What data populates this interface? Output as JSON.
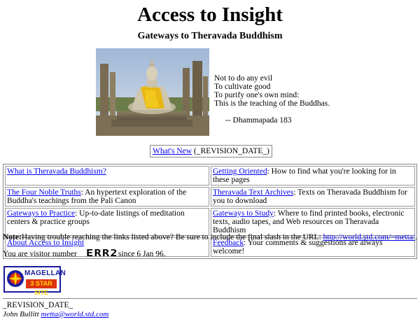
{
  "header": {
    "title": "Access to Insight",
    "subtitle": "Gateways to Theravada Buddhism"
  },
  "hero": {
    "image": "buddha-statue-photo"
  },
  "quote": {
    "lines": [
      "Not to do any evil",
      "To cultivate good",
      "To purify one's own mind:",
      "This is the teaching of the Buddhas."
    ],
    "attribution": "-- Dhammapada 183"
  },
  "whats_new": {
    "link": "What's New",
    "date": "(_REVISION_DATE_)"
  },
  "nav": [
    [
      {
        "link": "What is Theravada Buddhism?",
        "desc": ""
      },
      {
        "link": "Getting Oriented",
        "desc": ": How to find what you're looking for in these pages"
      }
    ],
    [
      {
        "link": "The Four Noble Truths",
        "desc": ": An hypertext exploration of the Buddha's teachings from the Pali Canon"
      },
      {
        "link": "Theravada Text Archives",
        "desc": ": Texts on Theravada Buddhism for you to download"
      }
    ],
    [
      {
        "link": "Gateways to Practice",
        "desc": ": Up-to-date listings of meditation centers & practice groups"
      },
      {
        "link": "Gateways to Study",
        "desc": ": Where to find printed books, electronic texts, audio tapes, and Web resources on Theravada Buddhism"
      }
    ],
    [
      {
        "link": "About Access to Insight",
        "desc": ""
      },
      {
        "link": "Feedback",
        "desc": ": Your comments & suggestions are always welcome!"
      }
    ]
  ],
  "note": {
    "label": "Note:",
    "text": "Having trouble reaching the links listed above? Be sure to include the final slash in the URL: ",
    "url": "http://world.std.com/~metta/",
    "end": "."
  },
  "visitor": {
    "prefix": "You are visitor number",
    "counter": "ERR2",
    "suffix": "since 6 Jan 96."
  },
  "badge": {
    "name": "MAGELLAN",
    "rating": "3 STAR SITE",
    "colors": {
      "border": "#1a1aa0",
      "ribbon": "#dd3311",
      "ribbon_text": "#ffd400"
    }
  },
  "footer": {
    "revision": "_REVISION_DATE_",
    "author": "John Bullitt",
    "email": "metta@world.std.com"
  }
}
